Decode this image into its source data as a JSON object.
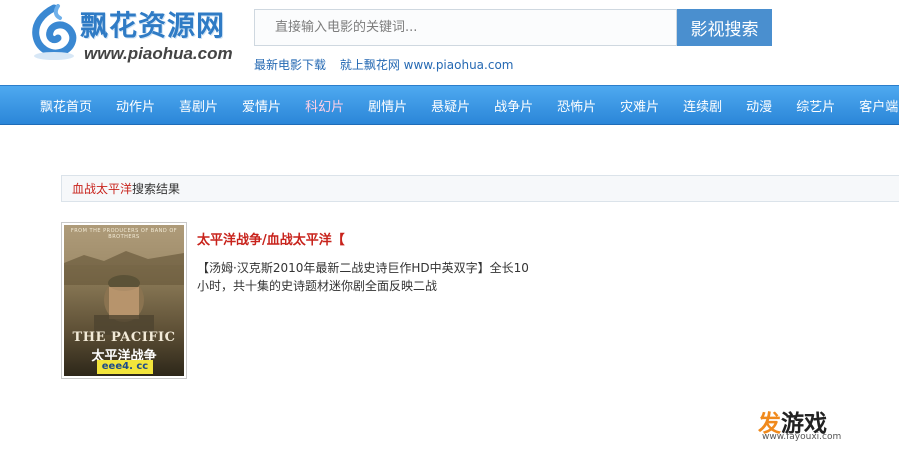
{
  "header": {
    "logo_title": "飘花资源网",
    "logo_domain": "www.piaohua.com",
    "search": {
      "placeholder": "直接输入电影的关键词...",
      "button_label": "影视搜索"
    },
    "tagline": {
      "text1": "最新电影下载",
      "text2": "就上飘花网 www.piaohua.com"
    }
  },
  "nav": {
    "items": [
      {
        "label": "飘花首页"
      },
      {
        "label": "动作片"
      },
      {
        "label": "喜剧片"
      },
      {
        "label": "爱情片"
      },
      {
        "label": "科幻片"
      },
      {
        "label": "剧情片"
      },
      {
        "label": "悬疑片"
      },
      {
        "label": "战争片"
      },
      {
        "label": "恐怖片"
      },
      {
        "label": "灾难片"
      },
      {
        "label": "连续剧"
      },
      {
        "label": "动漫"
      },
      {
        "label": "综艺片"
      },
      {
        "label": "客户端留"
      }
    ],
    "active": "科幻片"
  },
  "results": {
    "keyword": "血战太平洋",
    "suffix": "搜索结果",
    "items": [
      {
        "title": "太平洋战争/血战太平洋【",
        "description": "【汤姆·汉克斯2010年最新二战史诗巨作HD中英双字】全长10小时，共十集的史诗题材迷你剧全面反映二战",
        "poster": {
          "top_text": "FROM THE PRODUCERS OF BAND OF BROTHERS",
          "brand": "THE PACIFIC",
          "cn_title": "太平洋战争",
          "watermark": "eee4. cc"
        }
      }
    ]
  },
  "watermark": {
    "logo_a": "发",
    "logo_b": "游戏",
    "url": "www.fayouxi.com"
  },
  "colors": {
    "nav_blue": "#3795e3",
    "accent_red": "#c8231c",
    "search_button": "#4a8fcf"
  }
}
